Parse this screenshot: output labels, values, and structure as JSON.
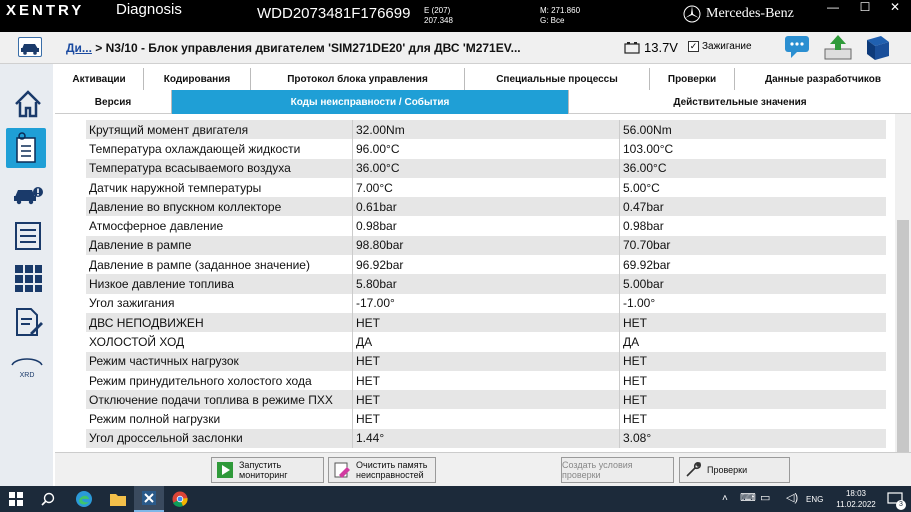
{
  "titlebar": {
    "brand": "XENTRY",
    "app": "Diagnosis",
    "vin": "WDD2073481F176699",
    "model_line1": "E (207)",
    "model_line2": "207.348",
    "m_line1": "M: 271.860",
    "m_line2": "G: Все",
    "maker": "Mercedes-Benz"
  },
  "toolbar": {
    "crumb_link": "Ди...",
    "crumb_text": "> N3/10 - Блок управления двигателем 'SIM271DE20' для ДВС 'M271EV...",
    "voltage": "13.7V",
    "ignition": "Зажигание"
  },
  "tabs_top": [
    "Активации",
    "Кодирования",
    "Протокол блока управления",
    "Специальные процессы",
    "Проверки",
    "Данные разработчиков"
  ],
  "tabs_second": [
    "Версия",
    "Коды неисправности / События",
    "Действительные значения"
  ],
  "rows": [
    {
      "name": "Крутящий момент двигателя",
      "v1": "32.00Nm",
      "v2": "56.00Nm"
    },
    {
      "name": "Температура охлаждающей жидкости",
      "v1": "96.00°C",
      "v2": "103.00°C"
    },
    {
      "name": "Температура всасываемого воздуха",
      "v1": "36.00°C",
      "v2": "36.00°C"
    },
    {
      "name": "Датчик наружной температуры",
      "v1": "7.00°C",
      "v2": "5.00°C"
    },
    {
      "name": "Давление во впускном коллекторе",
      "v1": "0.61bar",
      "v2": "0.47bar"
    },
    {
      "name": "Атмосферное давление",
      "v1": "0.98bar",
      "v2": "0.98bar"
    },
    {
      "name": "Давление в рампе",
      "v1": "98.80bar",
      "v2": "70.70bar"
    },
    {
      "name": "Давление в рампе (заданное значение)",
      "v1": "96.92bar",
      "v2": "69.92bar"
    },
    {
      "name": "Низкое давление топлива",
      "v1": "5.80bar",
      "v2": "5.00bar"
    },
    {
      "name": "Угол зажигания",
      "v1": "-17.00°",
      "v2": "-1.00°"
    },
    {
      "name": "ДВС НЕПОДВИЖЕН",
      "v1": "НЕТ",
      "v2": "НЕТ"
    },
    {
      "name": "ХОЛОСТОЙ ХОД",
      "v1": "ДА",
      "v2": "ДА"
    },
    {
      "name": "Режим частичных нагрузок",
      "v1": "НЕТ",
      "v2": "НЕТ"
    },
    {
      "name": "Режим принудительного холостого хода",
      "v1": "НЕТ",
      "v2": "НЕТ"
    },
    {
      "name": "Отключение подачи топлива в режиме ПХХ",
      "v1": "НЕТ",
      "v2": "НЕТ"
    },
    {
      "name": "Режим полной нагрузки",
      "v1": "НЕТ",
      "v2": "НЕТ"
    },
    {
      "name": "Угол дроссельной заслонки",
      "v1": "1.44°",
      "v2": "3.08°"
    }
  ],
  "bottom": {
    "start_line1": "Запустить",
    "start_line2": "мониторинг",
    "clear_line1": "Очистить память",
    "clear_line2": "неисправностей",
    "create_conditions": "Создать условия проверки",
    "checks": "Проверки"
  },
  "sidebar": {
    "xrd": "XRD"
  },
  "taskbar": {
    "lang": "ENG",
    "time": "18:03",
    "date": "11.02.2022",
    "notif_count": "3"
  },
  "colors": {
    "accent": "#1f9fd6",
    "titlebar": "#000000",
    "taskbar": "#1c2a3a"
  }
}
